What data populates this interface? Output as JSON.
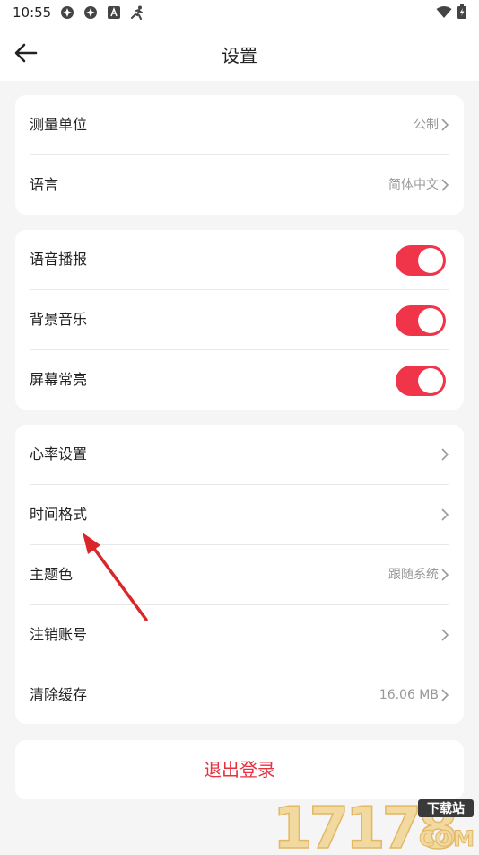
{
  "status_bar": {
    "time": "10:55"
  },
  "header": {
    "title": "设置"
  },
  "section1": [
    {
      "label": "测量单位",
      "value": "公制"
    },
    {
      "label": "语言",
      "value": "简体中文"
    }
  ],
  "section2": [
    {
      "label": "语音播报",
      "on": true
    },
    {
      "label": "背景音乐",
      "on": true
    },
    {
      "label": "屏幕常亮",
      "on": true
    }
  ],
  "section3": [
    {
      "label": "心率设置",
      "value": ""
    },
    {
      "label": "时间格式",
      "value": ""
    },
    {
      "label": "主题色",
      "value": "跟随系统"
    },
    {
      "label": "注销账号",
      "value": ""
    },
    {
      "label": "清除缓存",
      "value": "16.06 MB"
    }
  ],
  "logout_label": "退出登录",
  "watermark": {
    "number": "17178",
    "badge": "下载站",
    "domain": "COM"
  },
  "colors": {
    "accent": "#f0344a",
    "logout_text": "#e8313f",
    "annotation_arrow": "#d9262b"
  }
}
